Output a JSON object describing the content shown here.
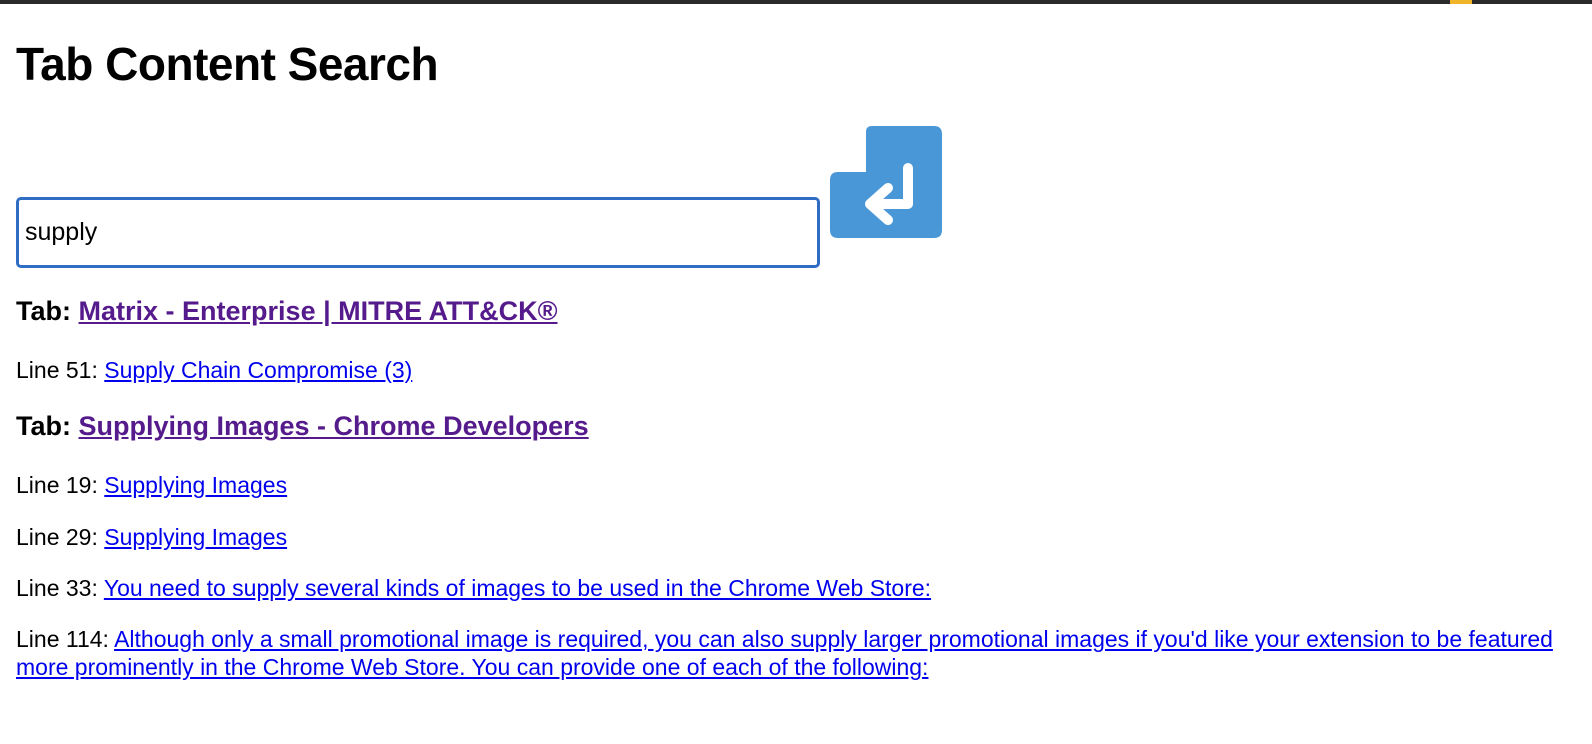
{
  "app": {
    "title": "Tab Content Search"
  },
  "search": {
    "value": "supply",
    "button_icon": "enter-return-icon",
    "button_color": "#4a97d8"
  },
  "colors": {
    "visited_link": "#551a8b",
    "link": "#0000ee",
    "input_border": "#2f6cc4"
  },
  "results": [
    {
      "tab_prefix": "Tab:",
      "tab_title": "Matrix - Enterprise | MITRE ATT&CK®",
      "lines": [
        {
          "prefix": "Line 51:",
          "text": "Supply Chain Compromise (3)"
        }
      ]
    },
    {
      "tab_prefix": "Tab:",
      "tab_title": "Supplying Images - Chrome Developers",
      "lines": [
        {
          "prefix": "Line 19:",
          "text": "Supplying Images"
        },
        {
          "prefix": "Line 29:",
          "text": "Supplying Images"
        },
        {
          "prefix": "Line 33:",
          "text": "You need to supply several kinds of images to be used in the Chrome Web Store:"
        },
        {
          "prefix": "Line 114:",
          "text": "Although only a small promotional image is required, you can also supply larger promotional images if you'd like your extension to be featured more prominently in the Chrome Web Store. You can provide one of each of the following:"
        }
      ]
    }
  ]
}
